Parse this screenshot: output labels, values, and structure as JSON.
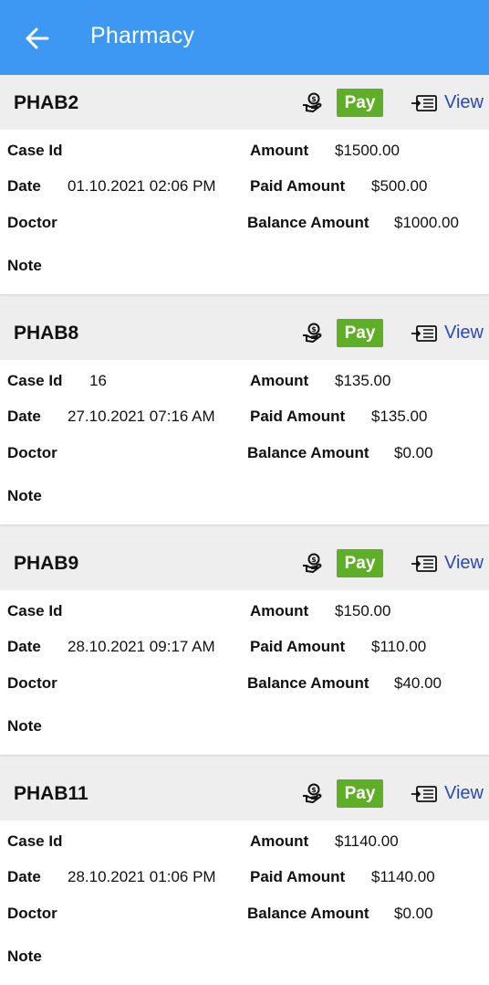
{
  "header": {
    "title": "Pharmacy"
  },
  "labels": {
    "case_id": "Case Id",
    "date": "Date",
    "doctor": "Doctor",
    "note": "Note",
    "amount": "Amount",
    "paid_amount": "Paid Amount",
    "balance_amount": "Balance Amount",
    "pay": "Pay",
    "view": "View"
  },
  "icons": {
    "back": "arrow-left-icon",
    "payment": "hand-coin-icon",
    "view": "receipt-list-icon"
  },
  "colors": {
    "appbar": "#3d98f3",
    "pay_button": "#5fae27",
    "view_link": "#2a49b8"
  },
  "bills": [
    {
      "bill_no": "PHAB2",
      "case_id": "",
      "date": "01.10.2021 02:06 PM",
      "doctor": "",
      "note": "",
      "amount": "$1500.00",
      "paid_amount": "$500.00",
      "balance_amount": "$1000.00"
    },
    {
      "bill_no": "PHAB8",
      "case_id": "16",
      "date": "27.10.2021 07:16 AM",
      "doctor": "",
      "note": "",
      "amount": "$135.00",
      "paid_amount": "$135.00",
      "balance_amount": "$0.00"
    },
    {
      "bill_no": "PHAB9",
      "case_id": "",
      "date": "28.10.2021 09:17 AM",
      "doctor": "",
      "note": "",
      "amount": "$150.00",
      "paid_amount": "$110.00",
      "balance_amount": "$40.00"
    },
    {
      "bill_no": "PHAB11",
      "case_id": "",
      "date": "28.10.2021 01:06 PM",
      "doctor": "",
      "note": "",
      "amount": "$1140.00",
      "paid_amount": "$1140.00",
      "balance_amount": "$0.00"
    }
  ]
}
